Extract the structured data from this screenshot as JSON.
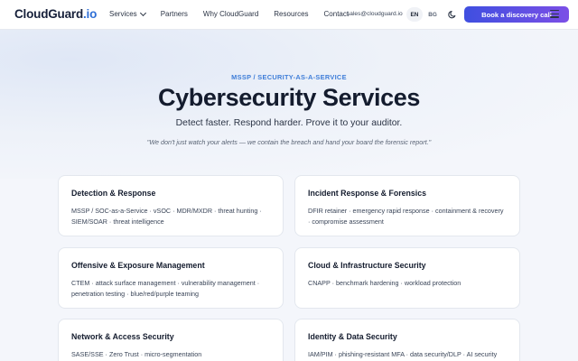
{
  "header": {
    "logo_main": "CloudGuard",
    "logo_tld": ".io",
    "nav": [
      {
        "label": "Services",
        "has_dropdown": true
      },
      {
        "label": "Partners"
      },
      {
        "label": "Why CloudGuard"
      },
      {
        "label": "Resources"
      },
      {
        "label": "Contact"
      }
    ],
    "email": "sales@cloudguard.io",
    "lang_en": "EN",
    "lang_bg": "BG",
    "theme_icon": "moon-icon",
    "cta_label": "Book a discovery call",
    "menu_icon": "hamburger-menu-icon"
  },
  "hero": {
    "eyebrow": "MSSP / SECURITY-AS-A-SERVICE",
    "title": "Cybersecurity Services",
    "subtitle": "Detect faster. Respond harder. Prove it to your auditor.",
    "quote": "\"We don't just watch your alerts — we contain the breach and hand your board the forensic report.\""
  },
  "cards": [
    {
      "title": "Detection & Response",
      "body": "MSSP / SOC-as-a-Service · vSOC · MDR/MXDR · threat hunting · SIEM/SOAR · threat intelligence"
    },
    {
      "title": "Incident Response & Forensics",
      "body": "DFIR retainer · emergency rapid response · containment & recovery · compromise assessment"
    },
    {
      "title": "Offensive & Exposure Management",
      "body": "CTEM · attack surface management · vulnerability management · penetration testing · blue/red/purple teaming"
    },
    {
      "title": "Cloud & Infrastructure Security",
      "body": "CNAPP · benchmark hardening · workload protection"
    },
    {
      "title": "Network & Access Security",
      "body": "SASE/SSE · Zero Trust · micro-segmentation"
    },
    {
      "title": "Identity & Data Security",
      "body": "IAM/PIM · phishing-resistant MFA · data security/DLP · AI security"
    }
  ],
  "colors": {
    "accent": "#3f7ed8",
    "cta_start": "#3f4fe0",
    "cta_end": "#7b4fe6"
  }
}
